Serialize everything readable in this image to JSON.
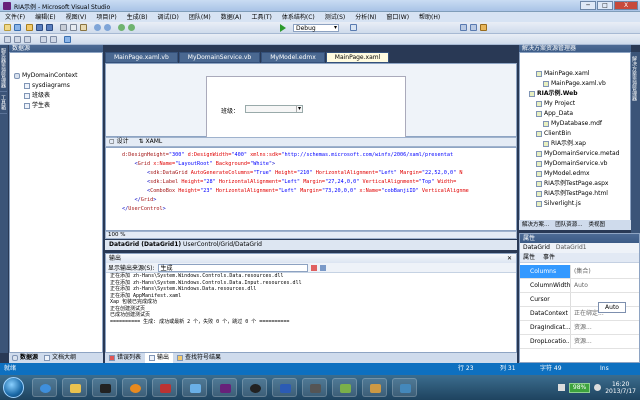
{
  "window": {
    "title": "RIA示例 - Microsoft Visual Studio",
    "controls": [
      "─",
      "□",
      "X"
    ]
  },
  "menubar": [
    "文件(F)",
    "编辑(E)",
    "视图(V)",
    "项目(P)",
    "生成(B)",
    "调试(D)",
    "团队(M)",
    "数据(A)",
    "工具(T)",
    "体系结构(C)",
    "测试(S)",
    "分析(N)",
    "窗口(W)",
    "帮助(H)"
  ],
  "toolbar": {
    "configuration": "Debug"
  },
  "left_tabs": [
    "服务器资源管理器",
    "工具箱"
  ],
  "datasource": {
    "header": "数据源",
    "items": [
      {
        "label": "MyDomainContext",
        "icon": "context-icon",
        "level": 0
      },
      {
        "label": "sysdiagrams",
        "icon": "table-icon",
        "level": 1
      },
      {
        "label": "班级表",
        "icon": "table-icon",
        "level": 1
      },
      {
        "label": "学生表",
        "icon": "table-icon",
        "level": 1
      }
    ],
    "bottom_tabs": [
      "数据源",
      "文档大纲"
    ]
  },
  "doc_tabs": [
    "MainPage.xaml.vb",
    "MyDomainService.vb",
    "MyModel.edmx",
    "MainPage.xaml"
  ],
  "designer": {
    "label": "班级："
  },
  "split_tabs": [
    "设计",
    "XAML"
  ],
  "xaml_lines": [
    [
      [
        "k",
        "d:DesignHeight="
      ],
      [
        "v",
        "\"300\" "
      ],
      [
        "a",
        "d:DesignWidth="
      ],
      [
        "v",
        "\"400\" "
      ],
      [
        "a",
        "xmlns:sdk="
      ],
      [
        "v",
        "\"http://schemas.microsoft.com/winfx/2006/xaml/presentat"
      ]
    ],
    [
      [
        "b",
        ""
      ]
    ],
    [
      [
        "b",
        "    <"
      ],
      [
        "k",
        "Grid "
      ],
      [
        "a",
        "x:Name="
      ],
      [
        "v",
        "\"LayoutRoot\" "
      ],
      [
        "a",
        "Background="
      ],
      [
        "v",
        "\"White\""
      ],
      [
        "b",
        ">"
      ]
    ],
    [
      [
        "b",
        "        <"
      ],
      [
        "k",
        "sdk:DataGrid "
      ],
      [
        "a",
        "AutoGenerateColumns="
      ],
      [
        "v",
        "\"True\" "
      ],
      [
        "a",
        "Height="
      ],
      [
        "v",
        "\"210\" "
      ],
      [
        "a",
        "HorizontalAlignment="
      ],
      [
        "v",
        "\"Left\" "
      ],
      [
        "a",
        "Margin="
      ],
      [
        "v",
        "\"22,52,0,0\" "
      ],
      [
        "a",
        "N"
      ]
    ],
    [
      [
        "b",
        "        <"
      ],
      [
        "k",
        "sdk:Label "
      ],
      [
        "a",
        "Height="
      ],
      [
        "v",
        "\"28\" "
      ],
      [
        "a",
        "HorizontalAlignment="
      ],
      [
        "v",
        "\"Left\" "
      ],
      [
        "a",
        "Margin="
      ],
      [
        "v",
        "\"27,24,0,0\" "
      ],
      [
        "a",
        "VerticalAlignment="
      ],
      [
        "v",
        "\"Top\" "
      ],
      [
        "a",
        "Width="
      ]
    ],
    [
      [
        "b",
        "        <"
      ],
      [
        "k",
        "ComboBox "
      ],
      [
        "a",
        "Height="
      ],
      [
        "v",
        "\"23\" "
      ],
      [
        "a",
        "HorizontalAlignment="
      ],
      [
        "v",
        "\"Left\" "
      ],
      [
        "a",
        "Margin="
      ],
      [
        "v",
        "\"73,20,0,0\" "
      ],
      [
        "a",
        "x:Name="
      ],
      [
        "v",
        "\"cobBanjiID\" "
      ],
      [
        "a",
        "VerticalAlignme"
      ]
    ],
    [
      [
        "b",
        "    </"
      ],
      [
        "k",
        "Grid"
      ],
      [
        "b",
        ">"
      ]
    ],
    [
      [
        "b",
        "</"
      ],
      [
        "k",
        "UserControl"
      ],
      [
        "b",
        ">"
      ]
    ]
  ],
  "zoom": "100 %",
  "breadcrumb": {
    "bold": "DataGrid (DataGrid1)",
    "rest": "UserControl/Grid/DataGrid"
  },
  "output": {
    "header": "输出",
    "source_label": "显示输出来源(S):",
    "source_value": "生成",
    "lines": [
      "正在添加 zh-Hans\\System.Windows.Controls.Data.resources.dll",
      "正在添加 zh-Hans\\System.Windows.Controls.Data.Input.resources.dll",
      "正在添加 zh-Hans\\System.Windows.Data.resources.dll",
      "正在添加 AppManifest.xaml",
      "Xap 包装已完成成功",
      "正在创建测试页",
      "已成功创建测试页",
      "========== 生成: 成功或最新 2 个，失败 0 个，跳过 0 个 =========="
    ],
    "bottom_tabs": [
      "错误列表",
      "输出",
      "查找符号结果"
    ]
  },
  "solution": {
    "items": [
      {
        "label": "MainPage.xaml",
        "level": 2
      },
      {
        "label": "MainPage.xaml.vb",
        "level": 3
      },
      {
        "label": "RIA示例.Web",
        "level": 1,
        "bold": true
      },
      {
        "label": "My Project",
        "level": 2
      },
      {
        "label": "App_Data",
        "level": 2
      },
      {
        "label": "MyDatabase.mdf",
        "level": 3
      },
      {
        "label": "ClientBin",
        "level": 2
      },
      {
        "label": "RIA示例.xap",
        "level": 3
      },
      {
        "label": "MyDomainService.metad",
        "level": 2
      },
      {
        "label": "MyDomainService.vb",
        "level": 2
      },
      {
        "label": "MyModel.edmx",
        "level": 2
      },
      {
        "label": "RIA示例TestPage.aspx",
        "level": 2
      },
      {
        "label": "RIA示例TestPage.html",
        "level": 2
      },
      {
        "label": "Silverlight.js",
        "level": 2
      }
    ],
    "bottom_tabs": [
      "解决方案...",
      "团队资源...",
      "类视图"
    ]
  },
  "right_tabs": [
    "解决方案资源管理器"
  ],
  "properties": {
    "header": "属性",
    "object": "DataGrid",
    "object_name": "DataGrid1",
    "tabs": [
      "属性",
      "事件"
    ],
    "rows": [
      {
        "name": "Columns",
        "value": "(集合)",
        "selected": true
      },
      {
        "name": "ColumnWidth",
        "value": "Auto"
      },
      {
        "name": "Cursor",
        "value": ""
      },
      {
        "name": "DataContext",
        "value": "正在绑定..."
      },
      {
        "name": "DragIndicat...",
        "value": "资源..."
      },
      {
        "name": "DropLocatio...",
        "value": "资源..."
      }
    ],
    "auto_popup": "Auto"
  },
  "statusbar": {
    "ready": "就绪",
    "line": "行 23",
    "col": "列 31",
    "char": "字符 49",
    "mode": "Ins"
  },
  "taskbar": {
    "battery": "98%",
    "time": "16:20",
    "date": "2013/7/17"
  },
  "colors": {
    "statusbar": "#0e70c0",
    "frame": "#293955",
    "accent": "#3399ff"
  }
}
